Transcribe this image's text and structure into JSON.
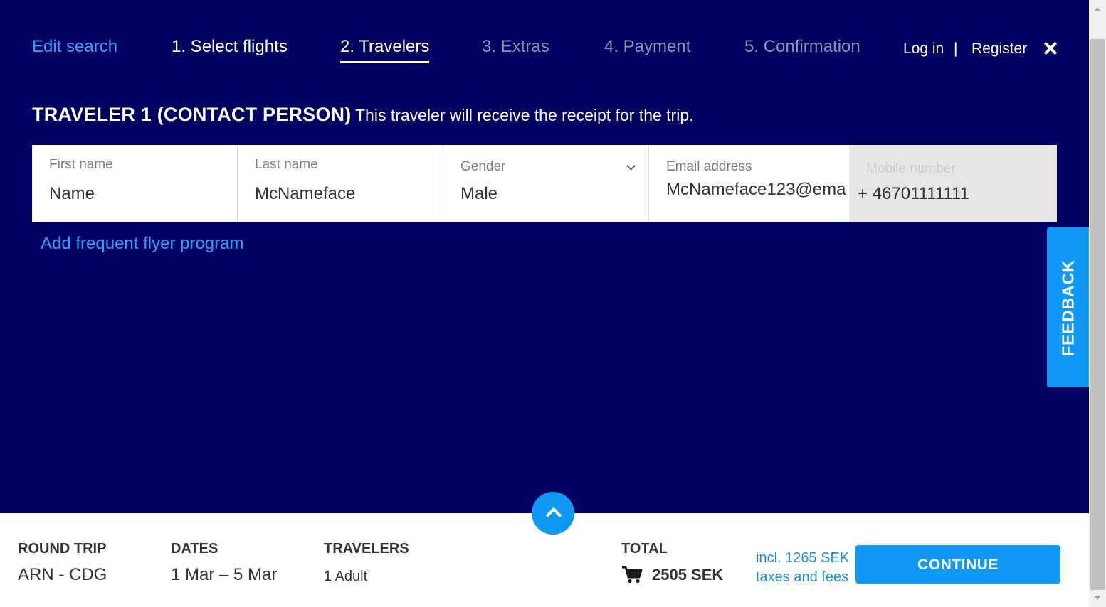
{
  "nav": {
    "edit_search": "Edit search",
    "steps": [
      {
        "label": "1. Select flights",
        "state": "done"
      },
      {
        "label": "2. Travelers",
        "state": "active"
      },
      {
        "label": "3. Extras",
        "state": "future"
      },
      {
        "label": "4. Payment",
        "state": "future"
      },
      {
        "label": "5. Confirmation",
        "state": "future"
      }
    ],
    "login": "Log in",
    "separator": "|",
    "register": "Register",
    "close_icon": "close-icon"
  },
  "traveler": {
    "title": "TRAVELER 1 (CONTACT PERSON)",
    "subtitle": "This traveler will receive the receipt for the trip.",
    "fields": {
      "first_name": {
        "label": "First name",
        "value": "Name"
      },
      "last_name": {
        "label": "Last name",
        "value": "McNameface"
      },
      "gender": {
        "label": "Gender",
        "value": "Male"
      },
      "email": {
        "label": "Email address",
        "value": "McNameface123@ema"
      },
      "mobile": {
        "label": "Mobile number",
        "value": "+ 46701111111"
      }
    },
    "add_ffp": "Add frequent flyer program"
  },
  "feedback": "FEEDBACK",
  "summary": {
    "trip_label": "ROUND TRIP",
    "trip_value": "ARN - CDG",
    "dates_label": "DATES",
    "dates_value": "1 Mar – 5 Mar",
    "travelers_label": "TRAVELERS",
    "travelers_value": "1 Adult",
    "total_label": "TOTAL",
    "total_value": "2505 SEK",
    "taxes_line1": "incl. 1265 SEK",
    "taxes_line2": "taxes and fees",
    "continue": "CONTINUE"
  },
  "colors": {
    "background": "#000060",
    "accent": "#0f98f4",
    "link": "#2aa1ff"
  }
}
